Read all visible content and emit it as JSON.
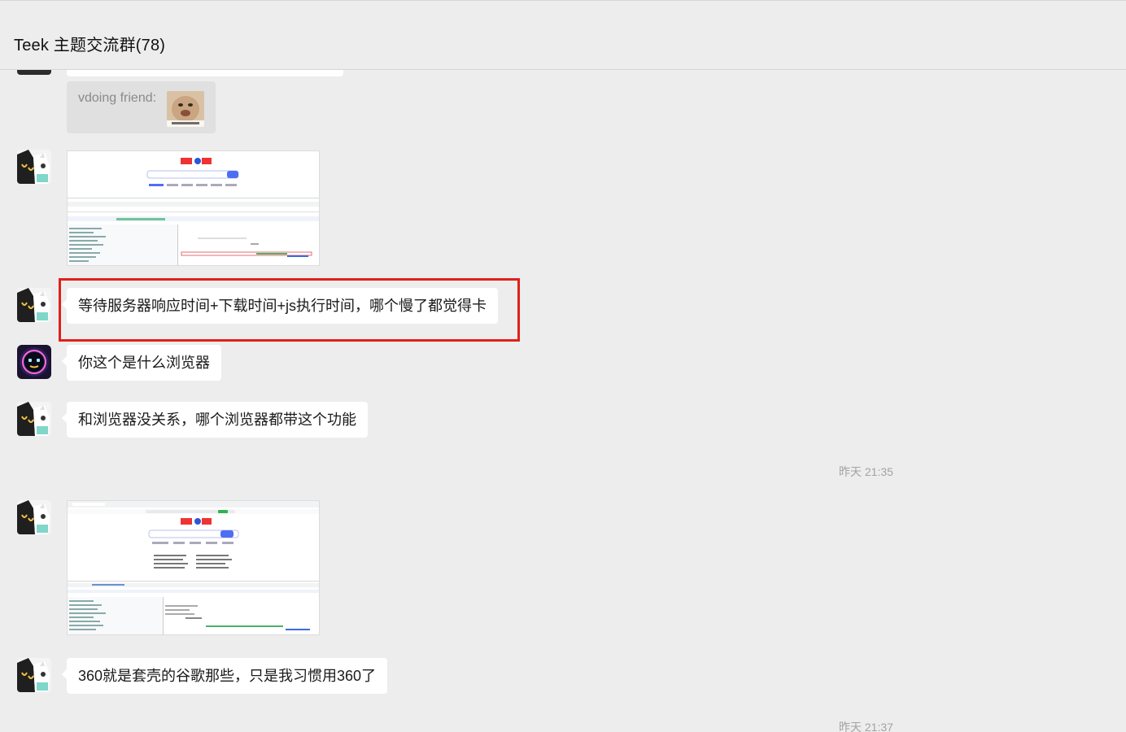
{
  "header": {
    "title": "Teek 主题交流群(78)"
  },
  "messages": {
    "quote": {
      "author_label": "vdoing friend:"
    },
    "m1_text": "等待服务器响应时间+下载时间+js执行时间，哪个慢了都觉得卡",
    "m2_text": "你这个是什么浏览器",
    "m3_text": "和浏览器没关系，哪个浏览器都带这个功能",
    "m4_text": "360就是套壳的谷歌那些，只是我习惯用360了"
  },
  "timestamps": {
    "t1": "昨天 21:35",
    "t2": "昨天 21:37"
  },
  "colors": {
    "background": "#ededed",
    "bubble": "#ffffff",
    "highlight": "#e0201c",
    "timestamp": "#a3a3a3"
  }
}
